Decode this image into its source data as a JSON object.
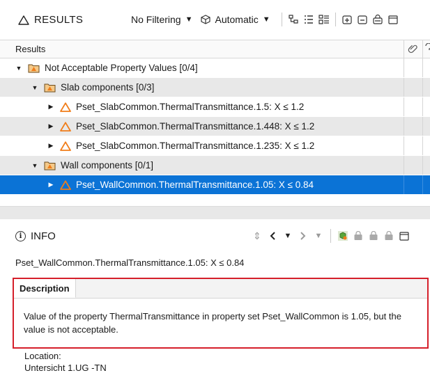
{
  "results_panel": {
    "title": "RESULTS",
    "filter_dropdown": "No Filtering",
    "mode_dropdown": "Automatic",
    "toolbar_icons": [
      "tree-view-icon",
      "list-view-icon",
      "grouped-view-icon",
      "add-rule-icon",
      "remove-rule-icon",
      "lock-rule-icon",
      "panel-icon"
    ],
    "column_header": "Results",
    "column_icons": [
      "link-icon",
      "help-icon"
    ]
  },
  "tree": {
    "root": {
      "label": "Not Acceptable Property Values [0/4]",
      "icon": "warning-folder-icon",
      "expanded": true
    },
    "groups": [
      {
        "label": "Slab components [0/3]",
        "icon": "warning-folder-icon",
        "expanded": true,
        "items": [
          {
            "label": "Pset_SlabCommon.ThermalTransmittance.1.5:  X ≤ 1.2",
            "icon": "warning-triangle-icon"
          },
          {
            "label": "Pset_SlabCommon.ThermalTransmittance.1.448:  X ≤ 1.2",
            "icon": "warning-triangle-icon"
          },
          {
            "label": "Pset_SlabCommon.ThermalTransmittance.1.235:  X ≤ 1.2",
            "icon": "warning-triangle-icon"
          }
        ]
      },
      {
        "label": "Wall components [0/1]",
        "icon": "warning-folder-icon",
        "expanded": true,
        "items": [
          {
            "label": "Pset_WallCommon.ThermalTransmittance.1.05:  X ≤ 0.84",
            "icon": "warning-triangle-icon",
            "selected": true
          }
        ]
      }
    ]
  },
  "info_panel": {
    "title": "INFO",
    "subject": "Pset_WallCommon.ThermalTransmittance.1.05:  X ≤ 0.84",
    "tab_label": "Description",
    "description": "Value of the property ThermalTransmittance in property set Pset_WallCommon is 1.05, but the value is not acceptable.",
    "location_label": "Location:",
    "location_value": "Untersicht 1.UG -TN"
  },
  "colors": {
    "selection": "#0b73d6",
    "shaded_row": "#e8e8e8",
    "warning_orange": "#f07d1a",
    "highlight_border": "#d51f2a"
  }
}
